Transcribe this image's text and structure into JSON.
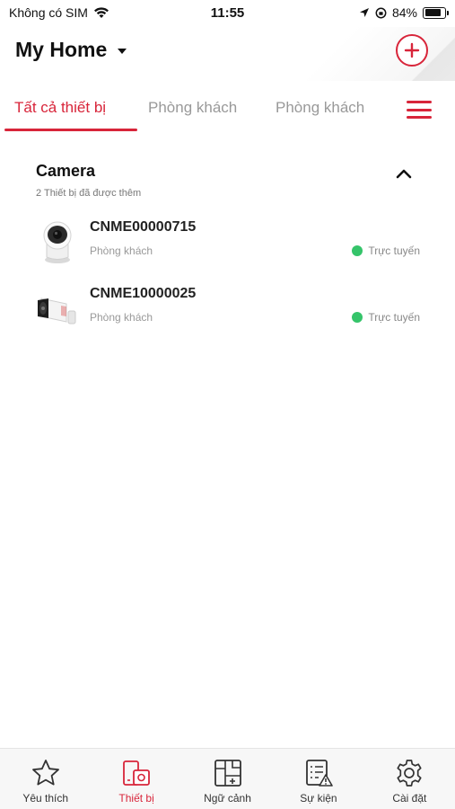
{
  "status_bar": {
    "carrier": "Không có SIM",
    "time": "11:55",
    "battery": "84%",
    "battery_level": 0.84
  },
  "header": {
    "home_name": "My Home"
  },
  "tabs": [
    {
      "label": "Tất cả thiết bị",
      "active": true
    },
    {
      "label": "Phòng khách",
      "active": false
    },
    {
      "label": "Phòng khách",
      "active": false
    }
  ],
  "section": {
    "title": "Camera",
    "subtitle": "2 Thiết bị đã được thêm"
  },
  "devices": [
    {
      "name": "CNME00000715",
      "room": "Phòng khách",
      "status": "Trực tuyến",
      "icon": "dome-camera-icon"
    },
    {
      "name": "CNME10000025",
      "room": "Phòng khách",
      "status": "Trực tuyến",
      "icon": "bullet-camera-icon"
    }
  ],
  "bottom_nav": [
    {
      "label": "Yêu thích",
      "icon": "star-icon",
      "active": false
    },
    {
      "label": "Thiết bị",
      "icon": "devices-icon",
      "active": true
    },
    {
      "label": "Ngữ cảnh",
      "icon": "scene-icon",
      "active": false
    },
    {
      "label": "Sự kiện",
      "icon": "event-list-icon",
      "active": false
    },
    {
      "label": "Cài đặt",
      "icon": "gear-icon",
      "active": false
    }
  ],
  "colors": {
    "accent": "#d8253a",
    "online": "#35c46a"
  }
}
